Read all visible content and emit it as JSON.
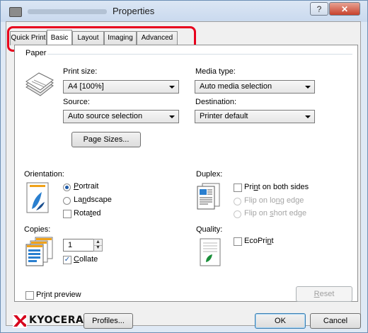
{
  "window": {
    "title": "Properties"
  },
  "titlebar": {
    "help_label": "?",
    "close_label": "✕"
  },
  "tabs": [
    {
      "label": "Quick Print"
    },
    {
      "label": "Basic"
    },
    {
      "label": "Layout"
    },
    {
      "label": "Imaging"
    },
    {
      "label": "Advanced"
    }
  ],
  "paper": {
    "group_label": "Paper",
    "print_size_label": "Print size:",
    "print_size_value": "A4 [100%]",
    "media_type_label": "Media type:",
    "media_type_value": "Auto media selection",
    "source_label": "Source:",
    "source_value": "Auto source selection",
    "destination_label": "Destination:",
    "destination_value": "Printer default",
    "page_sizes_label": "Page Sizes..."
  },
  "orientation": {
    "label": "Orientation:",
    "options": [
      {
        "pre": "",
        "u": "P",
        "post": "ortrait",
        "checked": true
      },
      {
        "pre": "La",
        "u": "n",
        "post": "dscape",
        "checked": false
      }
    ],
    "rotated": {
      "pre": "Rota",
      "u": "t",
      "post": "ed",
      "checked": false
    }
  },
  "duplex": {
    "label": "Duplex:",
    "both_sides": {
      "pre": "Pri",
      "u": "n",
      "post": "t on both sides",
      "checked": false
    },
    "long_edge": {
      "pre": "Flip on lo",
      "u": "n",
      "post": "g edge"
    },
    "short_edge": {
      "pre": "Flip on ",
      "u": "s",
      "post": "hort edge"
    }
  },
  "copies": {
    "label": "Copies:",
    "value": "1",
    "collate": {
      "pre": "",
      "u": "C",
      "post": "ollate",
      "checked": true
    }
  },
  "quality": {
    "label": "Quality:",
    "ecoprint": {
      "pre": "EcoPri",
      "u": "n",
      "post": "t",
      "checked": false
    }
  },
  "footer": {
    "print_preview": {
      "pre": "Pr",
      "u": "i",
      "post": "nt preview",
      "checked": false
    },
    "reset_pre": "",
    "reset_u": "R",
    "reset_post": "eset",
    "brand": "KYOCERA",
    "profiles_label": "Profiles...",
    "ok_label": "OK",
    "cancel_label": "Cancel"
  },
  "colors": {
    "accent": "#1d5aa8",
    "highlight": "#e8001c",
    "brand_red": "#d7001c"
  }
}
